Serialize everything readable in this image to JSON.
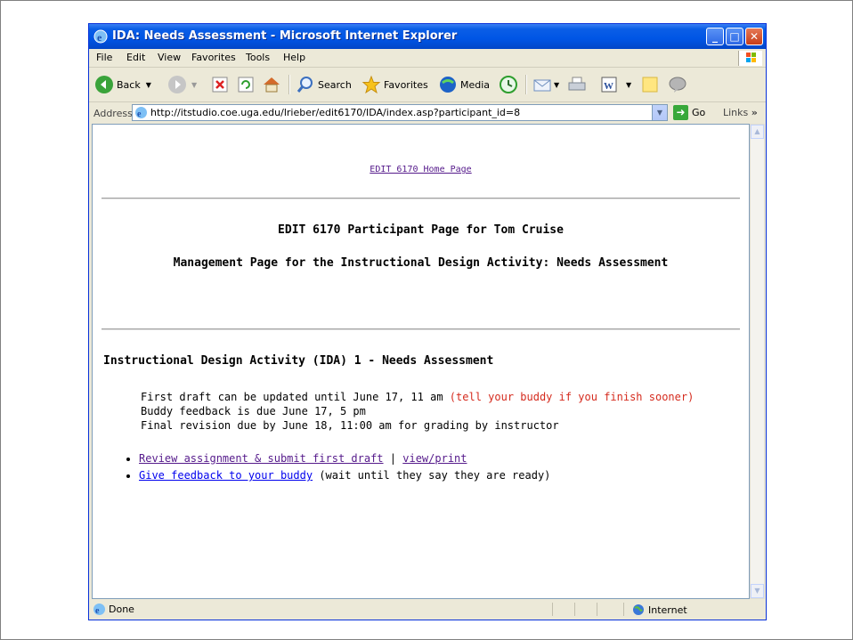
{
  "window": {
    "title": "IDA: Needs Assessment - Microsoft Internet Explorer"
  },
  "menubar": {
    "items": [
      "File",
      "Edit",
      "View",
      "Favorites",
      "Tools",
      "Help"
    ]
  },
  "toolbar": {
    "back_label": "Back",
    "search_label": "Search",
    "favorites_label": "Favorites",
    "media_label": "Media"
  },
  "addressbar": {
    "label": "Address",
    "url": "http://itstudio.coe.uga.edu/lrieber/edit6170/IDA/index.asp?participant_id=8",
    "go_label": "Go",
    "links_label": "Links"
  },
  "page": {
    "home_link": "EDIT 6170 Home Page",
    "participant_heading": "EDIT 6170 Participant Page for Tom Cruise",
    "management_heading": "Management Page for the Instructional Design Activity: Needs Assessment",
    "section_title": "Instructional Design Activity (IDA) 1 - Needs Assessment",
    "dates": {
      "first_draft": "First draft can be updated until June 17, 11 am",
      "first_draft_note": "(tell your buddy if you finish sooner)",
      "buddy_feedback": "Buddy feedback is due June 17, 5 pm",
      "final_revision": "Final revision due by June 18, 11:00 am for grading by instructor"
    },
    "actions": {
      "review_link": "Review assignment & submit first draft",
      "separator": "|",
      "view_print_link": "view/print",
      "feedback_link": "Give feedback to your buddy",
      "feedback_note": "(wait until they say they are ready)"
    }
  },
  "statusbar": {
    "status": "Done",
    "zone": "Internet"
  },
  "colors": {
    "titlebar": "#0055e5",
    "visited_link": "#551a8b",
    "unvisited_link": "#0000ee",
    "note_red": "#d52b1e"
  }
}
